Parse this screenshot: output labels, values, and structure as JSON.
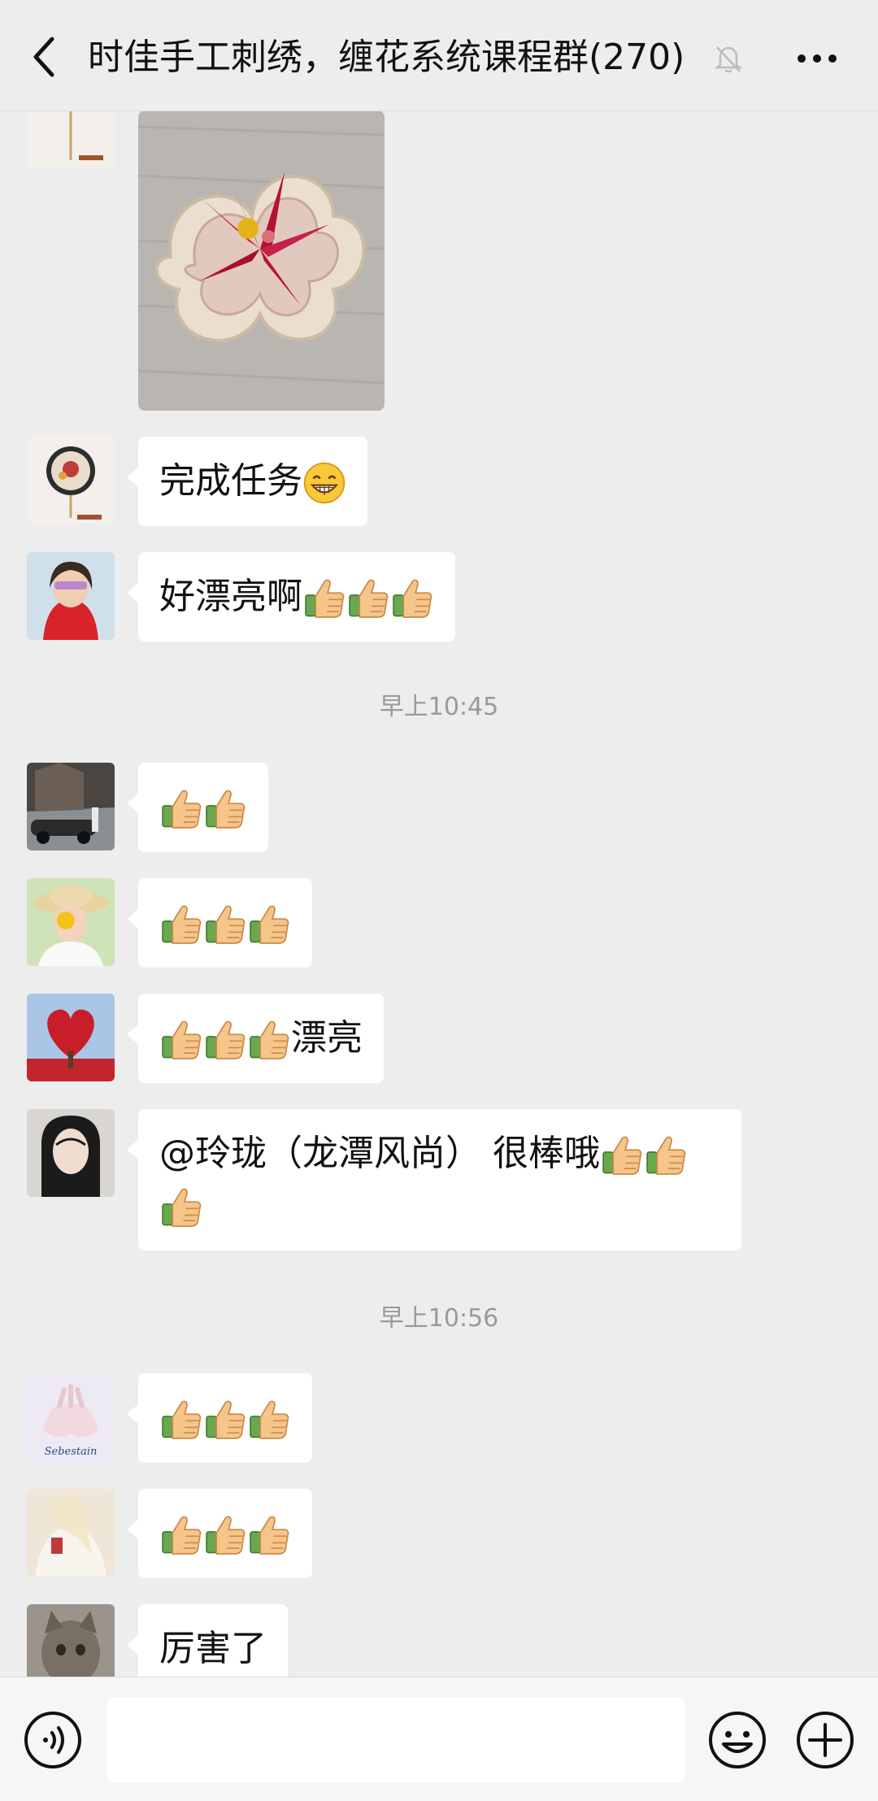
{
  "header": {
    "title": "时佳手工刺绣，缠花系统课程群(270)"
  },
  "messages": [
    {
      "type": "image",
      "content": "flower embroidery photo"
    },
    {
      "type": "text",
      "text": "完成任务",
      "emoji": [
        "grin"
      ]
    },
    {
      "type": "text",
      "text": "好漂亮啊",
      "emoji": [
        "thumbs-up",
        "thumbs-up",
        "thumbs-up"
      ]
    },
    {
      "type": "timestamp",
      "text": "早上10:45"
    },
    {
      "type": "emoji",
      "emoji": [
        "thumbs-up",
        "thumbs-up"
      ]
    },
    {
      "type": "emoji",
      "emoji": [
        "thumbs-up",
        "thumbs-up",
        "thumbs-up"
      ]
    },
    {
      "type": "text",
      "text": "漂亮",
      "emoji_before": [
        "thumbs-up",
        "thumbs-up",
        "thumbs-up"
      ]
    },
    {
      "type": "text",
      "text": "@玲珑（龙潭风尚） 很棒哦",
      "emoji": [
        "thumbs-up",
        "thumbs-up",
        "thumbs-up"
      ]
    },
    {
      "type": "timestamp",
      "text": "早上10:56"
    },
    {
      "type": "emoji",
      "emoji": [
        "thumbs-up",
        "thumbs-up",
        "thumbs-up"
      ]
    },
    {
      "type": "emoji",
      "emoji": [
        "thumbs-up",
        "thumbs-up",
        "thumbs-up"
      ]
    },
    {
      "type": "text",
      "text": "厉害了"
    }
  ],
  "avatar_labels": {
    "hands_avatar_caption": "Sebestain"
  },
  "icons": {
    "back": "back-arrow-icon",
    "mute": "bell-muted-icon",
    "more": "more-dots-icon",
    "voice": "voice-icon",
    "emoji": "emoji-icon",
    "plus": "plus-icon"
  }
}
